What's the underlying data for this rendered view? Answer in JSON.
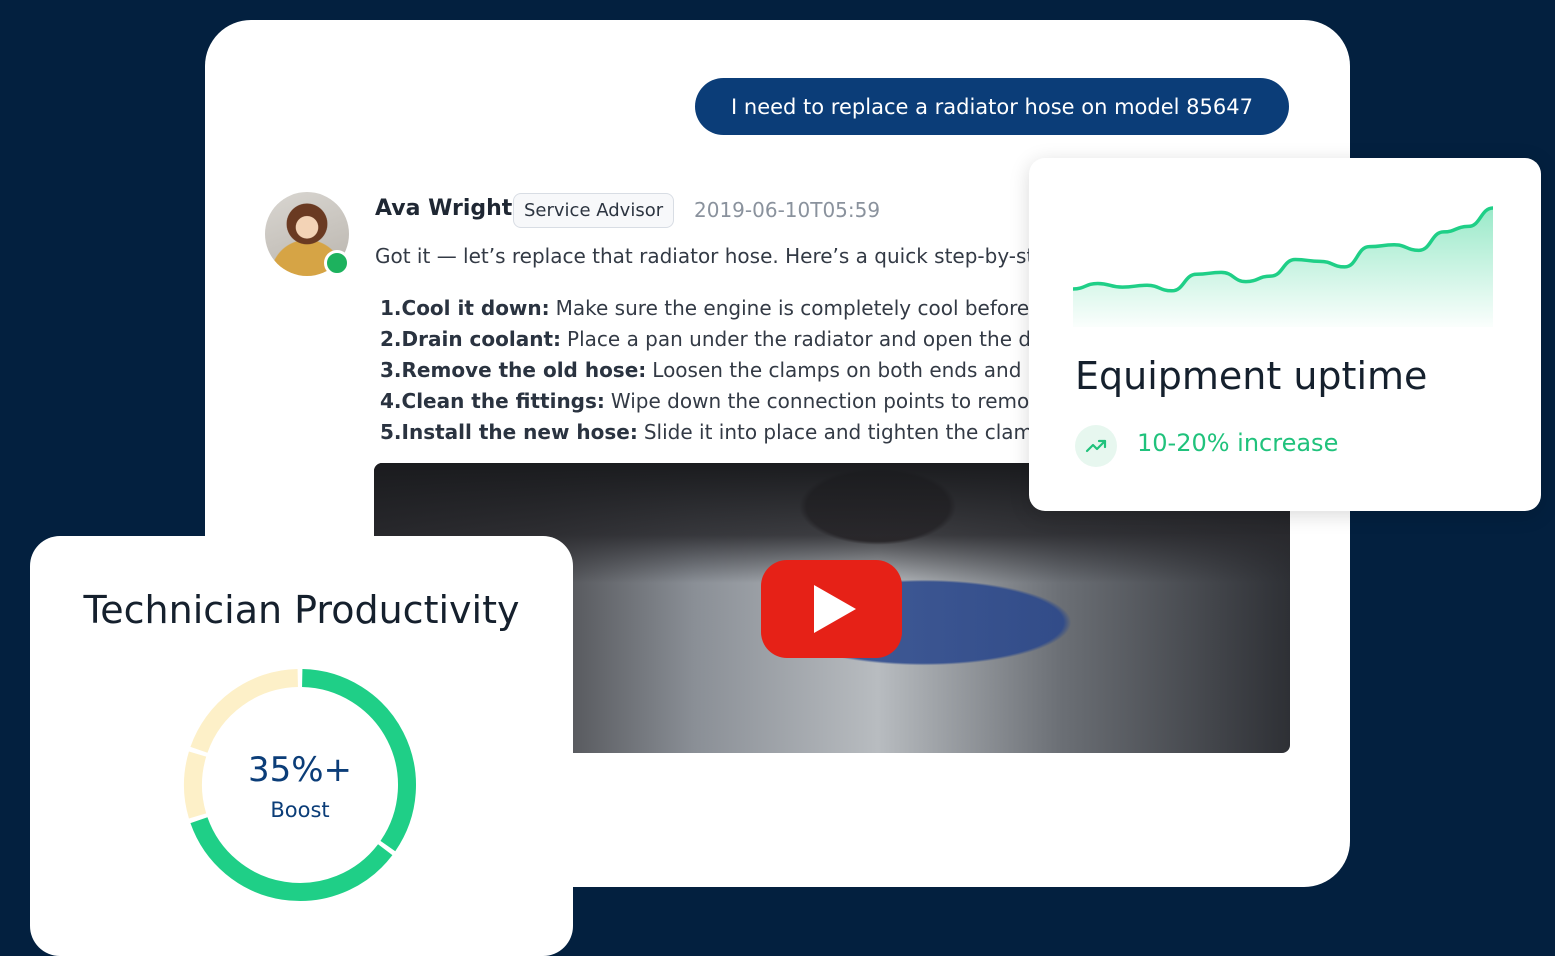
{
  "chat": {
    "user_message": "I need to replace a radiator hose on model 85647",
    "agent": {
      "name": "Ava Wright",
      "role": "Service Advisor",
      "timestamp": "2019-06-10T05:59",
      "status": "online"
    },
    "intro": "Got it — let’s replace that radiator hose. Here’s a quick step-by-step guide:",
    "steps": [
      {
        "num": "1.",
        "title": "Cool it down:",
        "text": "Make sure the engine is completely cool before starting."
      },
      {
        "num": "2.",
        "title": "Drain coolant:",
        "text": "Place a pan under the radiator and open the drain valve."
      },
      {
        "num": "3.",
        "title": "Remove the old hose:",
        "text": "Loosen the clamps on both ends and pull it off."
      },
      {
        "num": "4.",
        "title": "Clean the fittings:",
        "text": "Wipe down the connection points to remove debris."
      },
      {
        "num": "5.",
        "title": "Install the new hose:",
        "text": "Slide it into place and tighten the clamps."
      }
    ],
    "video": {
      "play_icon": "play-icon"
    }
  },
  "uptime_card": {
    "title": "Equipment uptime",
    "stat": "10-20% increase",
    "icon": "trend-up-icon",
    "accent_color": "#20c27c",
    "chart_data": {
      "type": "area",
      "values": [
        12,
        18,
        14,
        16,
        10,
        28,
        30,
        20,
        26,
        44,
        42,
        36,
        58,
        60,
        54,
        74,
        80,
        100
      ]
    }
  },
  "productivity_card": {
    "title": "Technician Productivity",
    "value": "35%+",
    "label": "Boost",
    "chart_data": {
      "type": "pie",
      "segments": [
        {
          "value": 35,
          "color": "#1fcf87"
        },
        {
          "value": 35,
          "color": "#1fcf87"
        },
        {
          "value": 10,
          "color": "#fdf0c8"
        },
        {
          "value": 20,
          "color": "#fdf0c8"
        }
      ]
    }
  },
  "colors": {
    "background": "#03203f",
    "user_bubble": "#0b3d78",
    "play_button": "#e62117"
  }
}
